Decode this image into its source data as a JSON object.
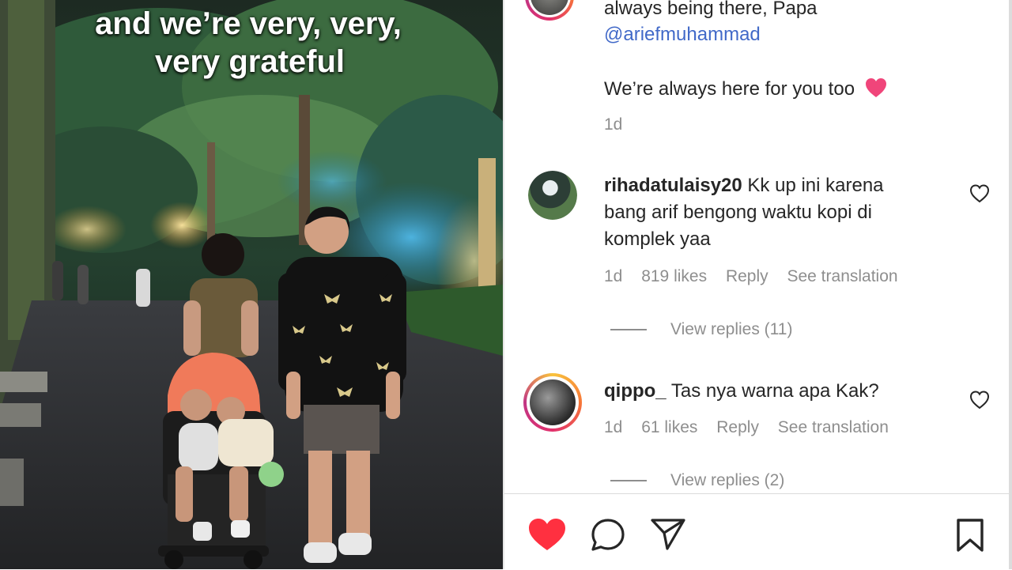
{
  "video": {
    "caption_line1": "and we’re very, very,",
    "caption_line2": "very grateful"
  },
  "comments": {
    "top": {
      "text_partial": "always being there, Papa",
      "mention": "@ariefmuhammad",
      "reply": "We’re always here for you too",
      "emoji": "heart-emoji",
      "age": "1d"
    },
    "items": [
      {
        "username": "rihadatulaisy20",
        "text_line1": " Kk up ini karena",
        "text_line2": "bang arif bengong waktu kopi di",
        "text_line3": "komplek yaa",
        "age": "1d",
        "likes": "819 likes",
        "reply_label": "Reply",
        "translate_label": "See translation",
        "view_replies": "View replies (11)"
      },
      {
        "username": "qippo_",
        "text_line1": " Tas nya warna apa Kak?",
        "age": "1d",
        "likes": "61 likes",
        "reply_label": "Reply",
        "translate_label": "See translation",
        "view_replies": "View replies (2)"
      }
    ]
  },
  "actions": {
    "like_icon": "heart-filled-icon",
    "comment_icon": "comment-icon",
    "share_icon": "send-icon",
    "save_icon": "bookmark-icon",
    "like_color": "#ff3040"
  }
}
